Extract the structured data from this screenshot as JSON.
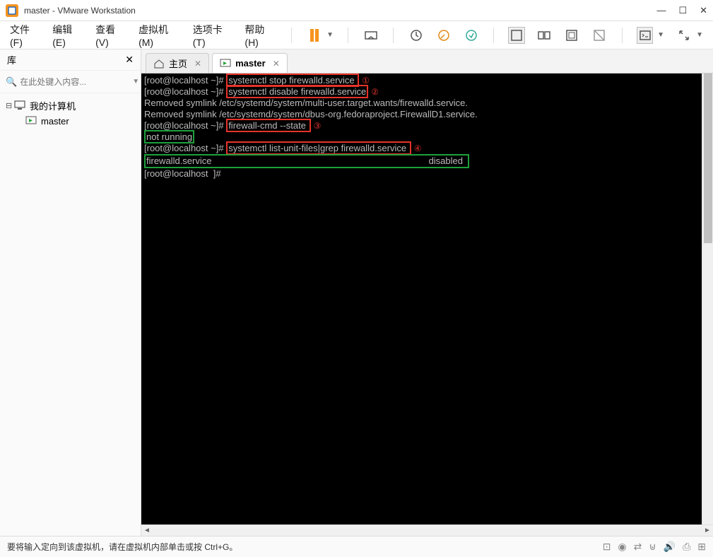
{
  "window": {
    "title": "master - VMware Workstation"
  },
  "menubar": {
    "file": "文件(F)",
    "edit": "编辑(E)",
    "view": "查看(V)",
    "vm": "虚拟机(M)",
    "tabs": "选项卡(T)",
    "help": "帮助(H)"
  },
  "sidebar": {
    "title": "库",
    "search_placeholder": "在此处键入内容...",
    "root": "我的计算机",
    "child": "master"
  },
  "tabs": {
    "home": "主页",
    "master": "master"
  },
  "terminal": {
    "p1": "[root@localhost ~]# ",
    "cmd1": "systemctl stop firewalld.service ",
    "n1": "①",
    "p2": "[root@localhost ~]# ",
    "cmd2": "systemctl disable firewalld.service",
    "n2": "②",
    "l3": "Removed symlink /etc/systemd/system/multi-user.target.wants/firewalld.service.",
    "l4": "Removed symlink /etc/systemd/system/dbus-org.fedoraproject.FirewallD1.service.",
    "p5": "[root@localhost ~]# ",
    "cmd5": "firewall-cmd --state ",
    "n5": "③",
    "l6": "not running",
    "p7": "[root@localhost ~]# ",
    "cmd7": "systemctl list-unit-files|grep firewalld.service ",
    "n7": "④",
    "l8a": "firewalld.service",
    "l8b": "disabled",
    "p9": "[root@localhost  ]# "
  },
  "statusbar": {
    "text": "要将输入定向到该虚拟机，请在虚拟机内部单击或按 Ctrl+G。"
  }
}
